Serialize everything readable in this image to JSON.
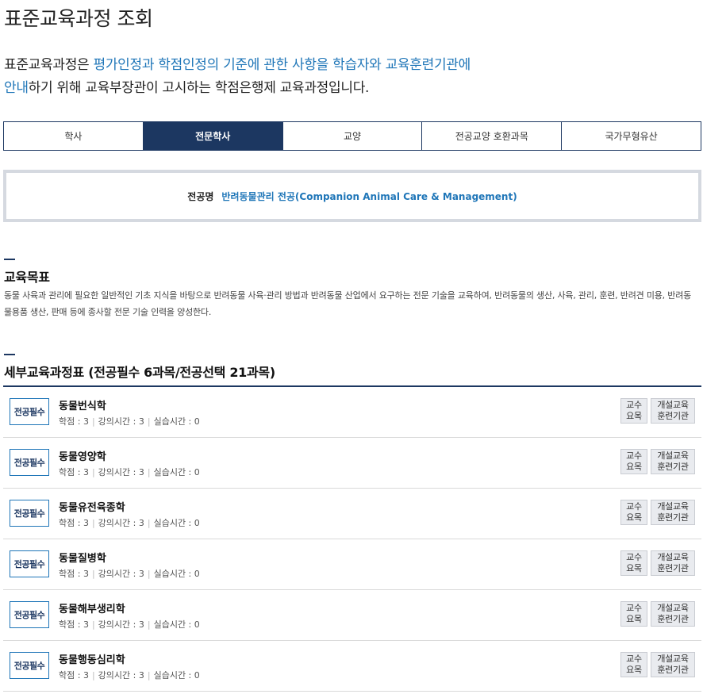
{
  "page": {
    "title": "표준교육과정 조회",
    "intro": {
      "line1_a": "표준교육과정은 ",
      "line1_hl": "평가인정과 학점인정의 기준에 관한 사항을 학습자와 교육훈련기관에",
      "line2_hl": "안내",
      "line2_b": "하기 위해 교육부장관이 고시하는 학점은행제 교육과정입니다."
    }
  },
  "tabs": [
    {
      "label": "학사",
      "active": false
    },
    {
      "label": "전문학사",
      "active": true
    },
    {
      "label": "교양",
      "active": false
    },
    {
      "label": "전공교양 호환과목",
      "active": false
    },
    {
      "label": "국가무형유산",
      "active": false
    }
  ],
  "major": {
    "label": "전공명",
    "value": "반려동물관리 전공(Companion Animal Care & Management)"
  },
  "goal": {
    "title": "교육목표",
    "text": "동물 사육과 관리에 필요한 일반적인 기초 지식을 바탕으로 반려동물 사육·관리 방법과 반려동물 산업에서 요구하는 전문 기술을 교육하여, 반려동물의 생산, 사육, 관리, 훈련, 반려견 미용, 반려동물용품 생산, 판매 등에 종사할 전문 기술 인력을 양성한다."
  },
  "curriculum": {
    "title": "세부교육과정표 (전공필수 6과목/전공선택 21과목)",
    "courses": [
      {
        "type": "전공필수",
        "name": "동물번식학",
        "credit": "학점 : 3",
        "lecture": "강의시간 : 3",
        "practice": "실습시간 : 0",
        "btn_prof": "교수\n요목",
        "btn_inst": "개설교육\n훈련기관"
      },
      {
        "type": "전공필수",
        "name": "동물영양학",
        "credit": "학점 : 3",
        "lecture": "강의시간 : 3",
        "practice": "실습시간 : 0",
        "btn_prof": "교수\n요목",
        "btn_inst": "개설교육\n훈련기관"
      },
      {
        "type": "전공필수",
        "name": "동물유전육종학",
        "credit": "학점 : 3",
        "lecture": "강의시간 : 3",
        "practice": "실습시간 : 0",
        "btn_prof": "교수\n요목",
        "btn_inst": "개설교육\n훈련기관"
      },
      {
        "type": "전공필수",
        "name": "동물질병학",
        "credit": "학점 : 3",
        "lecture": "강의시간 : 3",
        "practice": "실습시간 : 0",
        "btn_prof": "교수\n요목",
        "btn_inst": "개설교육\n훈련기관"
      },
      {
        "type": "전공필수",
        "name": "동물해부생리학",
        "credit": "학점 : 3",
        "lecture": "강의시간 : 3",
        "practice": "실습시간 : 0",
        "btn_prof": "교수\n요목",
        "btn_inst": "개설교육\n훈련기관"
      },
      {
        "type": "전공필수",
        "name": "동물행동심리학",
        "credit": "학점 : 3",
        "lecture": "강의시간 : 3",
        "practice": "실습시간 : 0",
        "btn_prof": "교수\n요목",
        "btn_inst": "개설교육\n훈련기관"
      }
    ]
  },
  "colors": {
    "navy": "#1c3761",
    "accent_blue": "#1f76b8"
  }
}
